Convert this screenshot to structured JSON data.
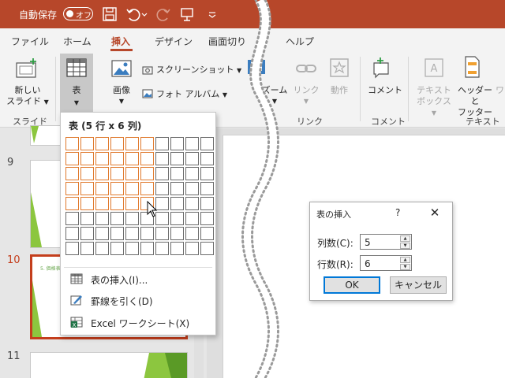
{
  "titlebar": {
    "autosave_label": "自動保存",
    "autosave_state": "オフ",
    "bg_color": "#b7472a"
  },
  "tabs": [
    {
      "label": "ファイル"
    },
    {
      "label": "ホーム"
    },
    {
      "label": "挿入",
      "active": true
    },
    {
      "label": "デザイン"
    },
    {
      "label": "画面切り"
    },
    {
      "label": "ヘルプ"
    }
  ],
  "ribbon": {
    "new_slide_line1": "新しい",
    "new_slide_line2": "スライド",
    "table_label": "表",
    "image_label": "画像",
    "screenshot_label": "スクリーンショット",
    "photo_album_label": "フォト アルバム",
    "zoom_label": "ズーム",
    "link_label": "リンク",
    "action_label": "動作",
    "comment_label": "コメント",
    "textbox_line1": "テキスト",
    "textbox_line2": "ボックス",
    "header_line1": "ヘッダーと",
    "header_line2": "フッター",
    "wordart_line1": "ワ",
    "group_slide": "スライド",
    "group_link": "リンク",
    "group_comment": "コメント",
    "group_text": "テキスト"
  },
  "slides": {
    "numbers": [
      "9",
      "10",
      "11"
    ],
    "active_index": 1,
    "active_thumb_text": "5. 価格表"
  },
  "table_menu": {
    "title": "表 (5 行 x 6 列)",
    "rows_total": 8,
    "cols_total": 10,
    "rows_selected": 5,
    "cols_selected": 6,
    "insert_table": "表の挿入(I)...",
    "draw_table": "罫線を引く(D)",
    "excel_sheet": "Excel ワークシート(X)"
  },
  "dialog": {
    "title": "表の挿入",
    "help": "?",
    "close": "✕",
    "cols_label": "列数(C):",
    "cols_value": "5",
    "rows_label": "行数(R):",
    "rows_value": "6",
    "ok": "OK",
    "cancel": "キャンセル"
  }
}
